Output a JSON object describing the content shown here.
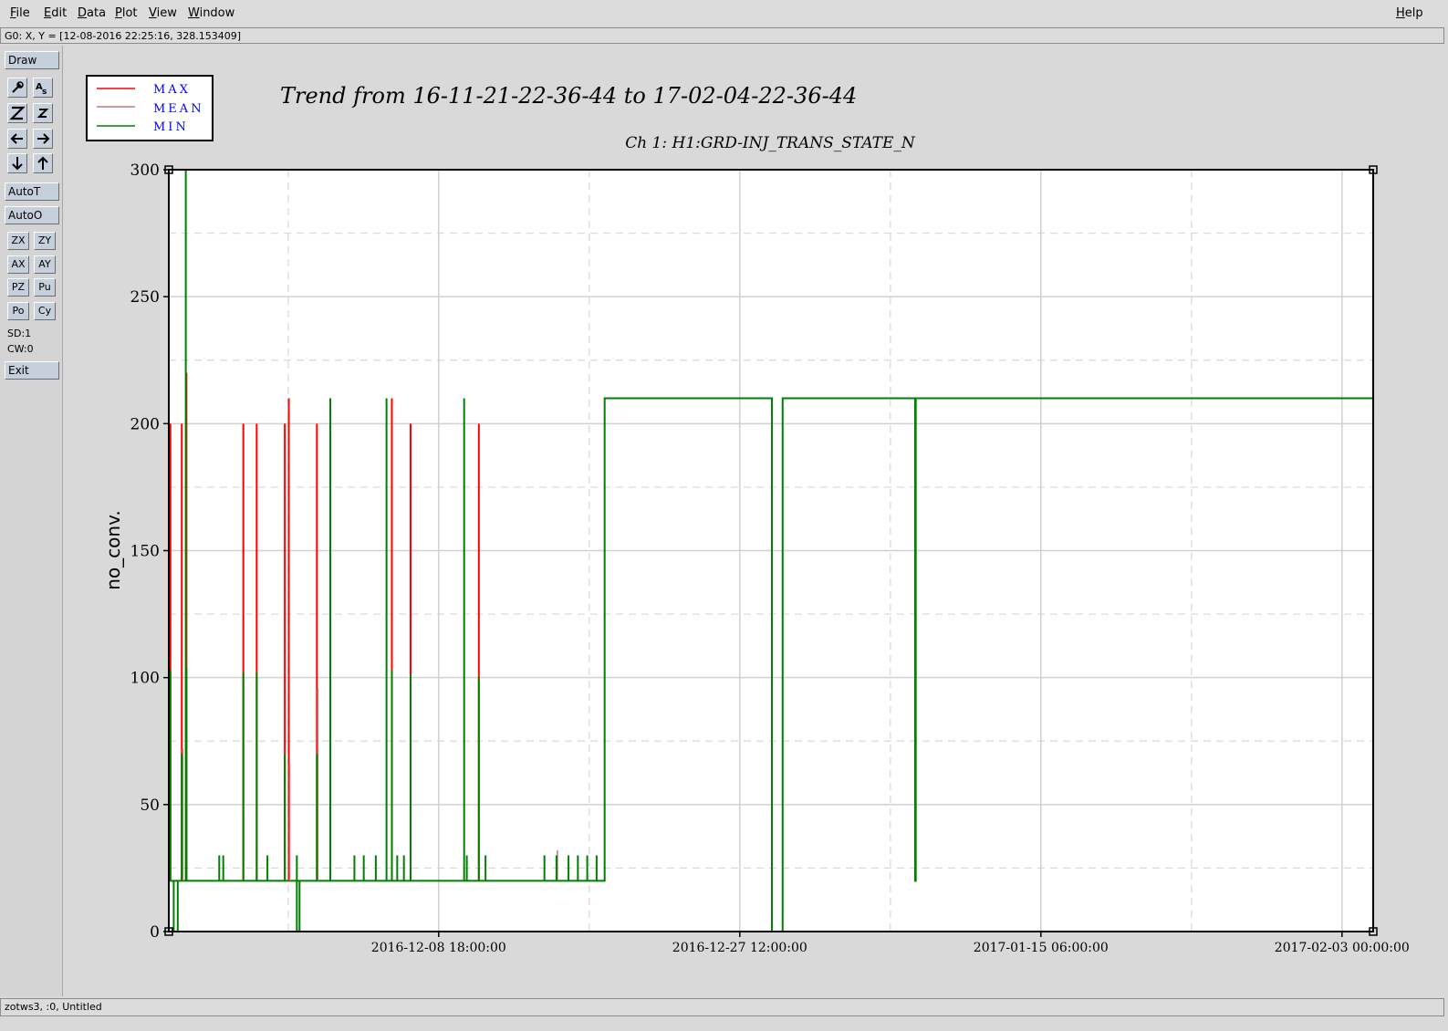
{
  "menu": {
    "file": "File",
    "edit": "Edit",
    "data": "Data",
    "plot": "Plot",
    "view": "View",
    "window": "Window",
    "help": "Help"
  },
  "status_line": "G0: X, Y = [12-08-2016 22:25:16, 328.153409]",
  "toolbar": {
    "draw": "Draw",
    "icons": [
      "pointer-icon",
      "text-tool-icon",
      "zoom-big-icon",
      "zoom-small-icon",
      "arrow-left-icon",
      "arrow-right-icon",
      "arrow-down-icon",
      "arrow-up-icon"
    ],
    "autot": "AutoT",
    "autoo": "AutoO",
    "zx": "ZX",
    "zy": "ZY",
    "ax": "AX",
    "ay": "AY",
    "pz": "PZ",
    "pu": "Pu",
    "po": "Po",
    "cy": "Cy",
    "sd": "SD:1",
    "cw": "CW:0",
    "exit": "Exit"
  },
  "bottom_status": "zotws3, :0, Untitled",
  "colors": {
    "max": "#ff0000",
    "mean": "#c07878",
    "min": "#008000",
    "legend_text": "#0000ff"
  },
  "chart_data": {
    "type": "line",
    "title": "Trend from 16-11-21-22-36-44 to 17-02-04-22-36-44",
    "subtitle": "Ch 1: H1:GRD-INJ_TRANS_STATE_N",
    "ylabel": "no_conv.",
    "xlabel": "",
    "x_range": [
      "2016-11-21 22:36:44",
      "2017-02-04 22:36:44"
    ],
    "ylim": [
      0,
      300
    ],
    "y_ticks": [
      0,
      50,
      100,
      150,
      200,
      250,
      300
    ],
    "x_ticks": [
      "2016-12-08 18:00:00",
      "2016-12-27 12:00:00",
      "2017-01-15 06:00:00",
      "2017-02-03 00:00:00"
    ],
    "grid": true,
    "legend_position": "top-left",
    "legend": [
      "MAX",
      "MEAN",
      "MIN"
    ],
    "series": [
      {
        "name": "MAX",
        "color": "#ff0000",
        "spikes": [
          {
            "t": "2016-11-22 01:00",
            "v": 200
          },
          {
            "t": "2016-11-22 18:00",
            "v": 200
          },
          {
            "t": "2016-11-23 01:00",
            "v": 220
          },
          {
            "t": "2016-11-26 14:00",
            "v": 200
          },
          {
            "t": "2016-11-27 10:00",
            "v": 200
          },
          {
            "t": "2016-11-29 04:00",
            "v": 200
          },
          {
            "t": "2016-11-29 10:00",
            "v": 210
          },
          {
            "t": "2016-12-01 04:00",
            "v": 200
          },
          {
            "t": "2016-12-05 20:00",
            "v": 210
          },
          {
            "t": "2016-12-07 00:00",
            "v": 200
          },
          {
            "t": "2016-12-11 06:00",
            "v": 200
          }
        ]
      },
      {
        "name": "MEAN",
        "color": "#c07878",
        "spikes": [
          {
            "t": "2016-11-22 18:00",
            "v": 72
          },
          {
            "t": "2016-11-29 10:00",
            "v": 66
          },
          {
            "t": "2016-12-01 04:00",
            "v": 96
          },
          {
            "t": "2016-12-16 02:00",
            "v": 32
          }
        ]
      },
      {
        "name": "MIN",
        "color": "#008000",
        "baseline": 20,
        "spikes": [
          {
            "t": "2016-11-22 01:00",
            "v": 103
          },
          {
            "t": "2016-11-22 18:00",
            "v": 70
          },
          {
            "t": "2016-11-23 00:00",
            "v": 300
          },
          {
            "t": "2016-11-23 01:00",
            "v": 104
          },
          {
            "t": "2016-11-25 02:00",
            "v": 30
          },
          {
            "t": "2016-11-25 08:00",
            "v": 30
          },
          {
            "t": "2016-11-26 14:00",
            "v": 102
          },
          {
            "t": "2016-11-27 10:00",
            "v": 102
          },
          {
            "t": "2016-11-28 02:00",
            "v": 30
          },
          {
            "t": "2016-11-29 04:00",
            "v": 70
          },
          {
            "t": "2016-11-29 22:00",
            "v": 30
          },
          {
            "t": "2016-12-01 04:00",
            "v": 70
          },
          {
            "t": "2016-12-02 00:00",
            "v": 210
          },
          {
            "t": "2016-12-03 12:00",
            "v": 30
          },
          {
            "t": "2016-12-04 02:00",
            "v": 30
          },
          {
            "t": "2016-12-04 20:00",
            "v": 30
          },
          {
            "t": "2016-12-05 12:00",
            "v": 210
          },
          {
            "t": "2016-12-05 20:00",
            "v": 103
          },
          {
            "t": "2016-12-06 04:00",
            "v": 30
          },
          {
            "t": "2016-12-06 14:00",
            "v": 30
          },
          {
            "t": "2016-12-07 00:00",
            "v": 101
          },
          {
            "t": "2016-12-10 08:00",
            "v": 210
          },
          {
            "t": "2016-12-10 12:00",
            "v": 30
          },
          {
            "t": "2016-12-11 06:00",
            "v": 100
          },
          {
            "t": "2016-12-11 16:00",
            "v": 30
          },
          {
            "t": "2016-12-15 08:00",
            "v": 30
          },
          {
            "t": "2016-12-16 02:00",
            "v": 30
          },
          {
            "t": "2016-12-16 20:00",
            "v": 30
          },
          {
            "t": "2016-12-17 10:00",
            "v": 30
          },
          {
            "t": "2016-12-18 00:00",
            "v": 30
          },
          {
            "t": "2016-12-18 14:00",
            "v": 30
          }
        ],
        "dips": [
          {
            "t_start": "2016-11-22 06:00",
            "t_end": "2016-11-22 12:00",
            "v": 0
          },
          {
            "t_start": "2016-11-29 22:00",
            "t_end": "2016-11-30 02:00",
            "v": 0
          }
        ],
        "steps": [
          {
            "t": "2016-11-21 22:36",
            "v": 20
          },
          {
            "t": "2016-12-19 02:00",
            "v": 210
          },
          {
            "t": "2016-12-29 12:00",
            "v": 0
          },
          {
            "t": "2016-12-30 04:00",
            "v": 210
          },
          {
            "t": "2017-01-07 10:00",
            "v": 20
          },
          {
            "t": "2017-01-07 11:00",
            "v": 210
          },
          {
            "t": "2017-02-04 22:36",
            "v": 210
          }
        ]
      }
    ]
  }
}
